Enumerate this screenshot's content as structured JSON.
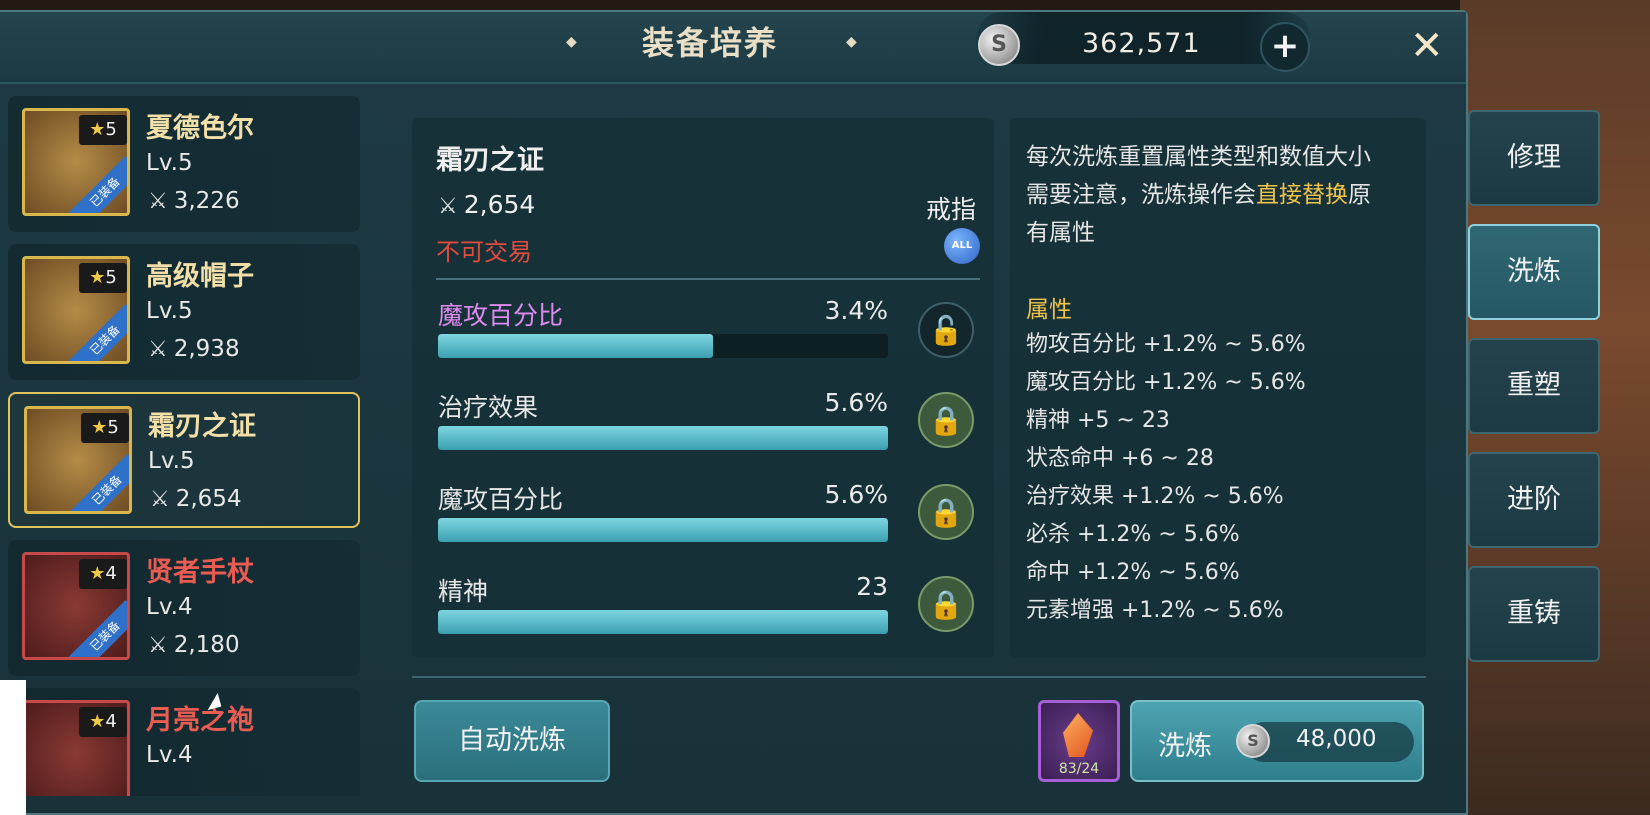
{
  "header": {
    "title": "装备培养",
    "currency_value": "362,571",
    "currency_icon": "silver-coin-icon",
    "coin_letter": "S",
    "add_symbol": "+",
    "close_symbol": "✕"
  },
  "equipment_list": [
    {
      "name": "夏德色尔",
      "level": "Lv.5",
      "power": "3,226",
      "stars": "5",
      "quality": "gold",
      "equipped": "已装备"
    },
    {
      "name": "高级帽子",
      "level": "Lv.5",
      "power": "2,938",
      "stars": "5",
      "quality": "gold",
      "equipped": "已装备"
    },
    {
      "name": "霜刃之证",
      "level": "Lv.5",
      "power": "2,654",
      "stars": "5",
      "quality": "gold",
      "equipped": "已装备",
      "selected": true
    },
    {
      "name": "贤者手杖",
      "level": "Lv.4",
      "power": "2,180",
      "stars": "4",
      "quality": "red",
      "equipped": "已装备"
    },
    {
      "name": "月亮之袍",
      "level": "Lv.4",
      "power": "",
      "stars": "4",
      "quality": "red",
      "equipped": ""
    }
  ],
  "selected_item": {
    "name": "霜刃之证",
    "power": "2,654",
    "trade_status": "不可交易",
    "slot": "戒指",
    "slot_badge": "ALL"
  },
  "stats": [
    {
      "label": "魔攻百分比",
      "value": "3.4%",
      "fill": 0.61,
      "color": "#df8af0",
      "locked": false
    },
    {
      "label": "治疗效果",
      "value": "5.6%",
      "fill": 1.0,
      "color": "#e6e6e6",
      "locked": true
    },
    {
      "label": "魔攻百分比",
      "value": "5.6%",
      "fill": 1.0,
      "color": "#e6e6e6",
      "locked": true
    },
    {
      "label": "精神",
      "value": "23",
      "fill": 1.0,
      "color": "#e6e6e6",
      "locked": true
    }
  ],
  "info": {
    "line1": "每次洗炼重置属性类型和数值大小",
    "line2_a": "需要注意，洗炼操作会",
    "line2_hl": "直接替换",
    "line2_b": "原",
    "line3": "有属性",
    "attr_title": "属性",
    "attributes": [
      "物攻百分比 +1.2% ~ 5.6%",
      "魔攻百分比 +1.2% ~ 5.6%",
      "精神 +5 ~ 23",
      "状态命中 +6 ~ 28",
      "治疗效果 +1.2% ~ 5.6%",
      "必杀 +1.2% ~ 5.6%",
      "命中 +1.2% ~ 5.6%",
      "元素增强 +1.2% ~ 5.6%"
    ]
  },
  "actions": {
    "auto_refine": "自动洗炼",
    "refine": "洗炼",
    "refine_cost": "48,000",
    "material_count": "83/24"
  },
  "side_tabs": [
    "修理",
    "洗炼",
    "重塑",
    "进阶",
    "重铸"
  ],
  "active_tab": "洗炼",
  "colors": {
    "gold": "#f3dfa8",
    "red_name": "#ea5b52",
    "highlight": "#f0c44a",
    "trade_red": "#e34b3e"
  }
}
